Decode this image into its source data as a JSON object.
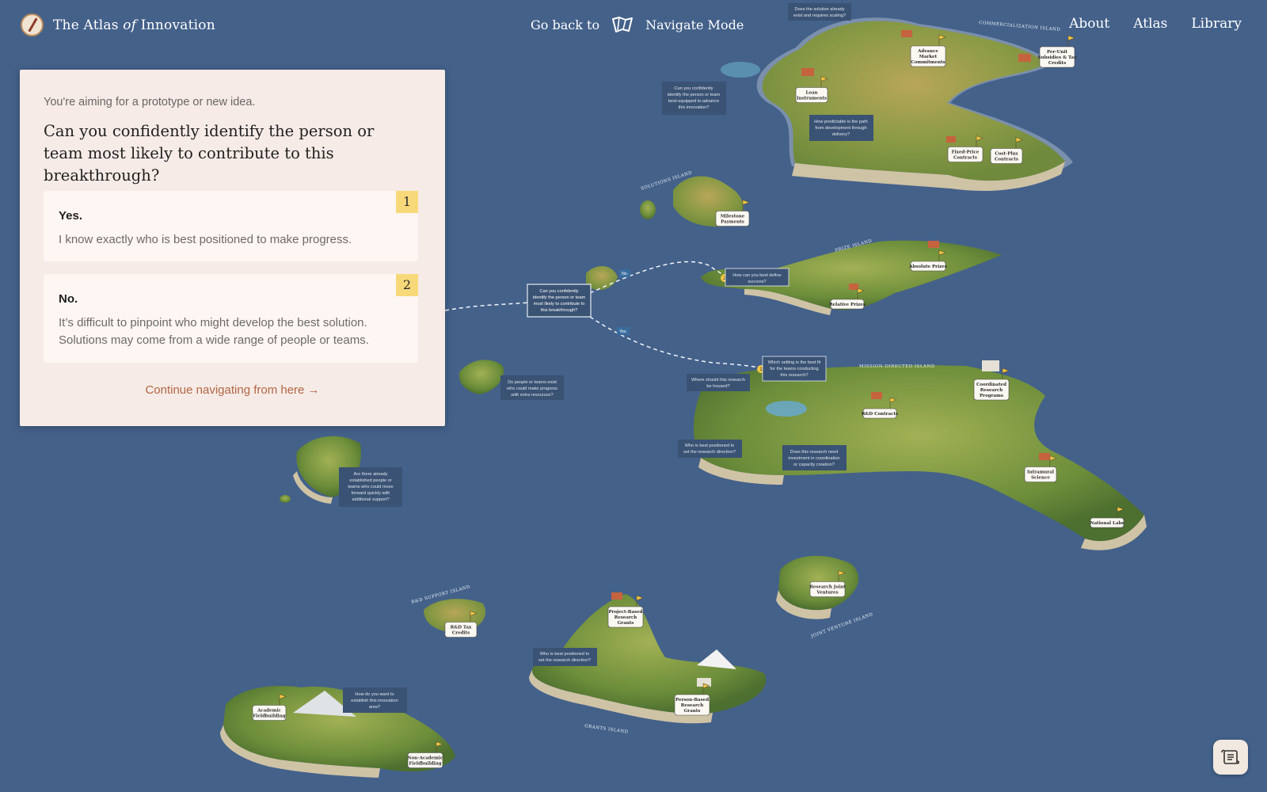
{
  "header": {
    "brand_pre": "The Atlas ",
    "brand_of": "of",
    "brand_post": " Innovation",
    "go_back": "Go back to",
    "navigate_mode": "Navigate Mode",
    "nav": [
      "About",
      "Atlas",
      "Library"
    ]
  },
  "card": {
    "context": "You're aiming for a prototype or new idea.",
    "question": "Can you confidently identify the person or team most likely to contribute to this breakthrough?",
    "options": [
      {
        "num": "1",
        "title": "Yes.",
        "desc": "I know exactly who is best positioned to make progress."
      },
      {
        "num": "2",
        "title": "No.",
        "desc": "It’s difficult to pinpoint who might develop the best solution. Solutions may come from a wide range of people or teams."
      }
    ],
    "continue": "Continue navigating from here →"
  },
  "map": {
    "current_question": [
      "Can you confidently",
      "identify the person or team",
      "most likely to contribute to",
      "this breakthrough?"
    ],
    "branch_no": "No.",
    "branch_yes": "Yes.",
    "badge_1": "1",
    "badge_2": "2",
    "q_scaling": [
      "Does the solution already",
      "exist and requires scaling?"
    ],
    "q_best_equipped": [
      "Can you confidently",
      "identify the person or team",
      "best-equipped to advance",
      "this innovation?"
    ],
    "q_predictable": [
      "How predictable is the path",
      "from development through",
      "delivery?"
    ],
    "q_define_success": [
      "How can you best define",
      "success?"
    ],
    "q_setting": [
      "Which setting is the best fit",
      "for the teams conducting",
      "this research?"
    ],
    "q_housed": [
      "Where should this research",
      "be housed?"
    ],
    "q_extra": [
      "Do people or teams exist",
      "who could make progress",
      "with extra resources?"
    ],
    "q_established": [
      "Are there already",
      "established people or",
      "teams who could move",
      "forward quickly with",
      "additional support?"
    ],
    "q_direction_1": [
      "Who is best positioned to",
      "set the research direction?"
    ],
    "q_coordination": [
      "Does this research need",
      "investment in coordination",
      "or capacity creation?"
    ],
    "q_direction_2": [
      "Who is best positioned to",
      "set the research direction?"
    ],
    "q_establish_area": [
      "How do you want to",
      "establish this innovation",
      "area?"
    ],
    "pins": {
      "advance_market": [
        "Advance",
        "Market",
        "Commitments"
      ],
      "per_unit": [
        "Per-Unit",
        "Subsidies & Tax",
        "Credits"
      ],
      "loan": [
        "Loan",
        "Instruments"
      ],
      "fixed_price": [
        "Fixed-Price",
        "Contracts"
      ],
      "cost_plus": [
        "Cost-Plus",
        "Contracts"
      ],
      "milestone": [
        "Milestone",
        "Payments"
      ],
      "absolute_prizes": [
        "Absolute Prizes"
      ],
      "relative_prizes": [
        "Relative Prizes"
      ],
      "coordinated": [
        "Coordinated",
        "Research",
        "Programs"
      ],
      "rd_contracts": [
        "R&D Contracts"
      ],
      "intramural": [
        "Intramural",
        "Science"
      ],
      "national_labs": [
        "National Labs"
      ],
      "research_joint": [
        "Research Joint",
        "Ventures"
      ],
      "rd_tax": [
        "R&D Tax",
        "Credits"
      ],
      "project_grants": [
        "Project-Based",
        "Research",
        "Grants"
      ],
      "person_grants": [
        "Person-Based",
        "Research",
        "Grants"
      ],
      "academic": [
        "Academic",
        "Fieldbuilding"
      ],
      "non_academic": [
        "Non-Academic",
        "Fieldbuilding"
      ]
    },
    "island_names": {
      "commercialization": "COMMERCIALIZATION ISLAND",
      "solutions": "SOLUTIONS ISLAND",
      "prize": "PRIZE ISLAND",
      "mission": "MISSION-DIRECTED ISLAND",
      "rd_support": "R&D SUPPORT ISLAND",
      "joint_venture": "JOINT VENTURE ISLAND",
      "grants": "GRANTS ISLAND"
    }
  },
  "colors": {
    "ocean": "#44618a",
    "card_bg": "#f6ebe6",
    "option_bg": "#fdf6f2",
    "number_badge": "#f8d97a",
    "continue_link": "#b26645",
    "question_box": "#3a5273"
  }
}
